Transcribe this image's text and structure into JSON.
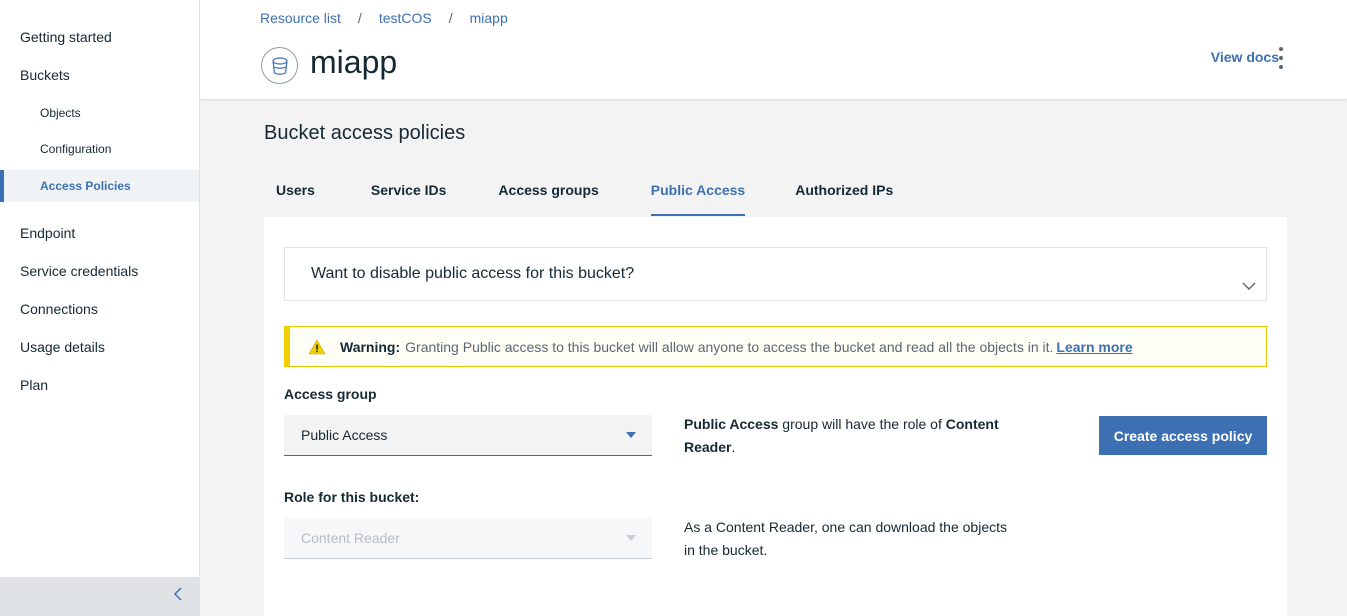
{
  "sidebar": {
    "items": [
      {
        "label": "Getting started"
      },
      {
        "label": "Buckets"
      },
      {
        "label": "Objects"
      },
      {
        "label": "Configuration"
      },
      {
        "label": "Access Policies"
      },
      {
        "label": "Endpoint"
      },
      {
        "label": "Service credentials"
      },
      {
        "label": "Connections"
      },
      {
        "label": "Usage details"
      },
      {
        "label": "Plan"
      }
    ],
    "active_item": "Access Policies",
    "collapse_icon": "chevron-left-icon"
  },
  "header": {
    "breadcrumbs": [
      "Resource list",
      "testCOS",
      "miapp"
    ],
    "separator": "/",
    "title": "miapp",
    "title_icon": "bucket-icon",
    "view_docs": "View docs",
    "overflow_icon": "overflow-menu-vertical-icon"
  },
  "main": {
    "section_title": "Bucket access policies",
    "tabs": [
      {
        "label": "Users"
      },
      {
        "label": "Service IDs"
      },
      {
        "label": "Access groups"
      },
      {
        "label": "Public Access"
      },
      {
        "label": "Authorized IPs"
      }
    ],
    "active_tab": "Public Access",
    "accordion": {
      "title": "Want to disable public access for this bucket?",
      "icon": "chevron-down-icon"
    },
    "warning": {
      "icon": "warning-icon",
      "strong": "Warning:",
      "text": "Granting Public access to this bucket will allow anyone to access the bucket and read all the objects in it.",
      "link": "Learn more"
    },
    "access_group": {
      "label": "Access group",
      "value": "Public Access",
      "description": {
        "group": "Public Access",
        "middle": " group will have the role of ",
        "role": "Content Reader",
        "end": "."
      }
    },
    "role": {
      "label": "Role for this bucket:",
      "value": "Content Reader",
      "description": "As a Content Reader, one can download the objects in the bucket."
    },
    "create_button": "Create access policy"
  },
  "colors": {
    "accent": "#3d70b2",
    "warning": "#f0d000",
    "text": "#152935",
    "background": "#f3f3f3"
  }
}
